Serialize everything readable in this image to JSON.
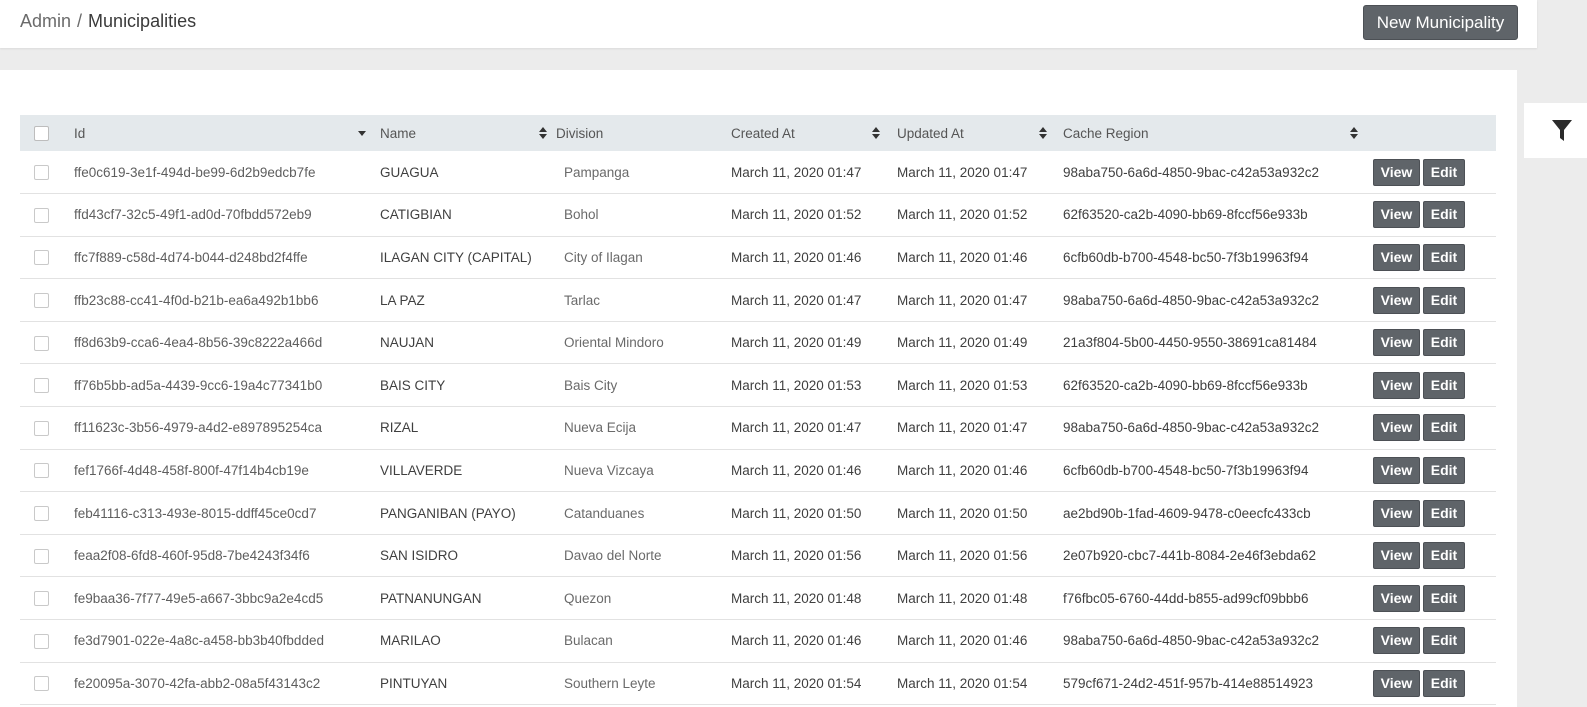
{
  "breadcrumb": {
    "root": "Admin",
    "separator": "/",
    "current": "Municipalities"
  },
  "header": {
    "new_button_label": "New Municipality"
  },
  "filter": {
    "icon": "filter-icon"
  },
  "table": {
    "columns": {
      "id": "Id",
      "name": "Name",
      "division": "Division",
      "created_at": "Created At",
      "updated_at": "Updated At",
      "cache_region": "Cache Region"
    },
    "actions": {
      "view": "View",
      "edit": "Edit"
    },
    "rows": [
      {
        "id": "ffe0c619-3e1f-494d-be99-6d2b9edcb7fe",
        "name": "GUAGUA",
        "division": "Pampanga",
        "created_at": "March 11, 2020 01:47",
        "updated_at": "March 11, 2020 01:47",
        "cache_region": "98aba750-6a6d-4850-9bac-c42a53a932c2"
      },
      {
        "id": "ffd43cf7-32c5-49f1-ad0d-70fbdd572eb9",
        "name": "CATIGBIAN",
        "division": "Bohol",
        "created_at": "March 11, 2020 01:52",
        "updated_at": "March 11, 2020 01:52",
        "cache_region": "62f63520-ca2b-4090-bb69-8fccf56e933b"
      },
      {
        "id": "ffc7f889-c58d-4d74-b044-d248bd2f4ffe",
        "name": "ILAGAN CITY (CAPITAL)",
        "division": "City of Ilagan",
        "created_at": "March 11, 2020 01:46",
        "updated_at": "March 11, 2020 01:46",
        "cache_region": "6cfb60db-b700-4548-bc50-7f3b19963f94"
      },
      {
        "id": "ffb23c88-cc41-4f0d-b21b-ea6a492b1bb6",
        "name": "LA PAZ",
        "division": "Tarlac",
        "created_at": "March 11, 2020 01:47",
        "updated_at": "March 11, 2020 01:47",
        "cache_region": "98aba750-6a6d-4850-9bac-c42a53a932c2"
      },
      {
        "id": "ff8d63b9-cca6-4ea4-8b56-39c8222a466d",
        "name": "NAUJAN",
        "division": "Oriental Mindoro",
        "created_at": "March 11, 2020 01:49",
        "updated_at": "March 11, 2020 01:49",
        "cache_region": "21a3f804-5b00-4450-9550-38691ca81484"
      },
      {
        "id": "ff76b5bb-ad5a-4439-9cc6-19a4c77341b0",
        "name": "BAIS CITY",
        "division": "Bais City",
        "created_at": "March 11, 2020 01:53",
        "updated_at": "March 11, 2020 01:53",
        "cache_region": "62f63520-ca2b-4090-bb69-8fccf56e933b"
      },
      {
        "id": "ff11623c-3b56-4979-a4d2-e897895254ca",
        "name": "RIZAL",
        "division": "Nueva Ecija",
        "created_at": "March 11, 2020 01:47",
        "updated_at": "March 11, 2020 01:47",
        "cache_region": "98aba750-6a6d-4850-9bac-c42a53a932c2"
      },
      {
        "id": "fef1766f-4d48-458f-800f-47f14b4cb19e",
        "name": "VILLAVERDE",
        "division": "Nueva Vizcaya",
        "created_at": "March 11, 2020 01:46",
        "updated_at": "March 11, 2020 01:46",
        "cache_region": "6cfb60db-b700-4548-bc50-7f3b19963f94"
      },
      {
        "id": "feb41116-c313-493e-8015-ddff45ce0cd7",
        "name": "PANGANIBAN (PAYO)",
        "division": "Catanduanes",
        "created_at": "March 11, 2020 01:50",
        "updated_at": "March 11, 2020 01:50",
        "cache_region": "ae2bd90b-1fad-4609-9478-c0eecfc433cb"
      },
      {
        "id": "feaa2f08-6fd8-460f-95d8-7be4243f34f6",
        "name": "SAN ISIDRO",
        "division": "Davao del Norte",
        "created_at": "March 11, 2020 01:56",
        "updated_at": "March 11, 2020 01:56",
        "cache_region": "2e07b920-cbc7-441b-8084-2e46f3ebda62"
      },
      {
        "id": "fe9baa36-7f77-49e5-a667-3bbc9a2e4cd5",
        "name": "PATNANUNGAN",
        "division": "Quezon",
        "created_at": "March 11, 2020 01:48",
        "updated_at": "March 11, 2020 01:48",
        "cache_region": "f76fbc05-6760-44dd-b855-ad99cf09bbb6"
      },
      {
        "id": "fe3d7901-022e-4a8c-a458-bb3b40fbdded",
        "name": "MARILAO",
        "division": "Bulacan",
        "created_at": "March 11, 2020 01:46",
        "updated_at": "March 11, 2020 01:46",
        "cache_region": "98aba750-6a6d-4850-9bac-c42a53a932c2"
      },
      {
        "id": "fe20095a-3070-42fa-abb2-08a5f43143c2",
        "name": "PINTUYAN",
        "division": "Southern Leyte",
        "created_at": "March 11, 2020 01:54",
        "updated_at": "March 11, 2020 01:54",
        "cache_region": "579cf671-24d2-451f-957b-414e88514923"
      }
    ]
  }
}
